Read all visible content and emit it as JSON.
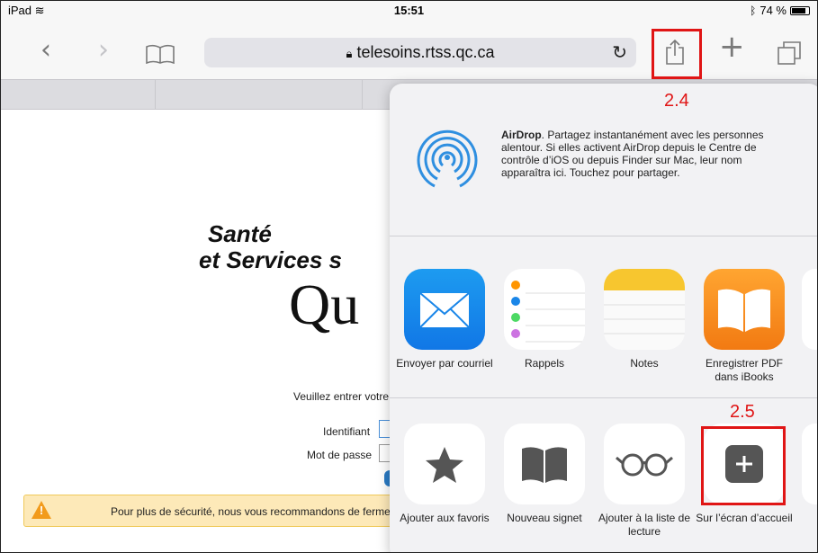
{
  "status_bar": {
    "device": "iPad",
    "time": "15:51",
    "battery": "74 %"
  },
  "browser": {
    "url": "telesoins.rtss.qc.ca"
  },
  "page": {
    "logo_line1": "Santé",
    "logo_line2": "et Services s",
    "logo_line3": "Qu",
    "instructions": "Veuillez entrer votre",
    "identifiant_label": "Identifiant",
    "password_label": "Mot de passe",
    "warning": "Pour plus de sécurité, nous vous recommandons de ferme"
  },
  "share_sheet": {
    "airdrop_title": "AirDrop",
    "airdrop_text": ". Partagez instantanément avec les personnes alentour. Si elles activent AirDrop depuis le Centre de contrôle d’iOS ou depuis Finder sur Mac, leur nom apparaîtra ici. Touchez pour partager.",
    "apps": [
      {
        "label": "Envoyer par courriel",
        "icon": "mail-icon"
      },
      {
        "label": "Rappels",
        "icon": "reminders-icon"
      },
      {
        "label": "Notes",
        "icon": "notes-icon"
      },
      {
        "label": "Enregistrer PDF dans iBooks",
        "icon": "ibooks-icon"
      }
    ],
    "actions": [
      {
        "label": "Ajouter aux favoris",
        "icon": "star-icon"
      },
      {
        "label": "Nouveau signet",
        "icon": "book-icon"
      },
      {
        "label": "Ajouter à la liste de lecture",
        "icon": "glasses-icon"
      },
      {
        "label": "Sur l’écran d’accueil",
        "icon": "plus-icon"
      }
    ]
  },
  "annotations": {
    "share_step": "2.4",
    "home_step": "2.5",
    "color": "#e01515"
  }
}
